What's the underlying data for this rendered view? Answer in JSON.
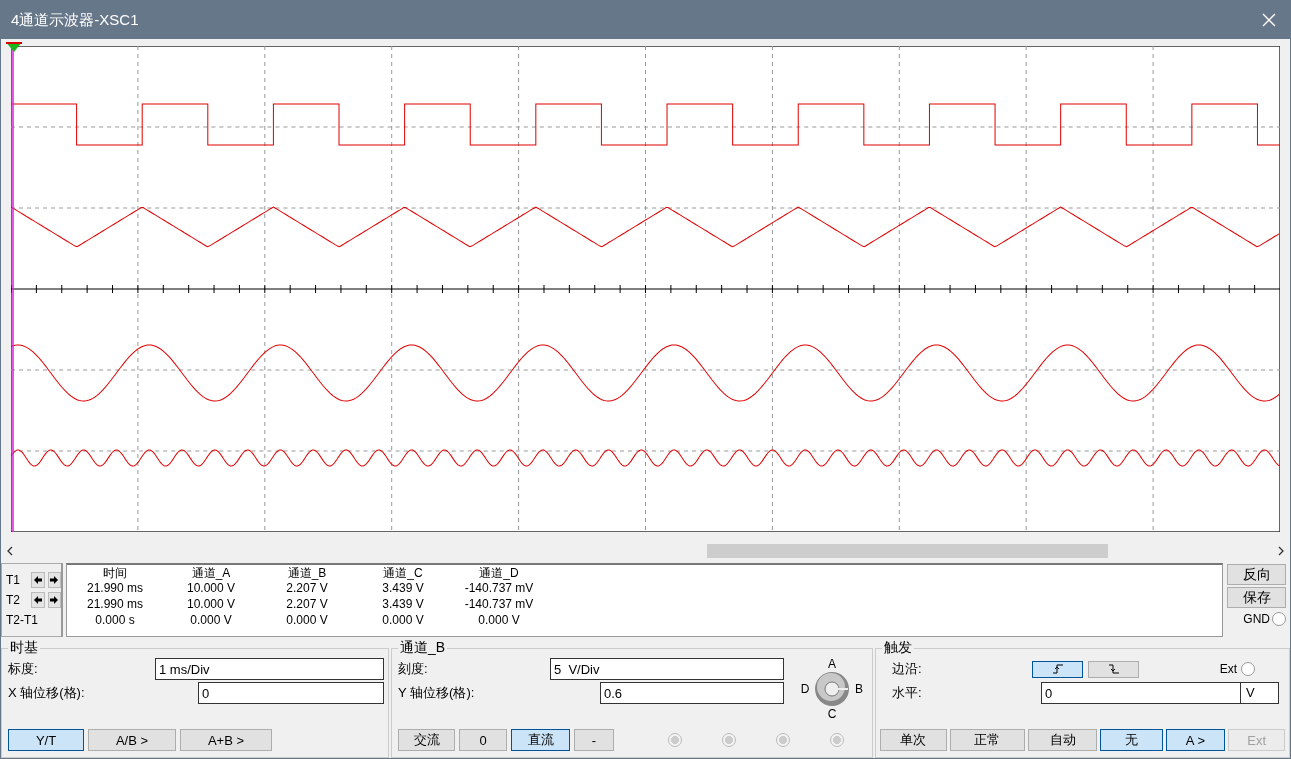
{
  "window": {
    "title": "4通道示波器-XSC1"
  },
  "display": {
    "traces": [
      {
        "kind": "square"
      },
      {
        "kind": "triangle"
      },
      {
        "kind": "sine"
      },
      {
        "kind": "ripple"
      }
    ]
  },
  "readout": {
    "columns": [
      "时间",
      "通道_A",
      "通道_B",
      "通道_C",
      "通道_D"
    ],
    "rows": [
      {
        "label": "T1",
        "arrows": true,
        "cells": [
          "21.990 ms",
          "10.000 V",
          "2.207 V",
          "3.439 V",
          "-140.737 mV"
        ]
      },
      {
        "label": "T2",
        "arrows": true,
        "cells": [
          "21.990 ms",
          "10.000 V",
          "2.207 V",
          "3.439 V",
          "-140.737 mV"
        ]
      },
      {
        "label": "T2-T1",
        "arrows": false,
        "cells": [
          "0.000 s",
          "0.000 V",
          "0.000 V",
          "0.000 V",
          "0.000 V"
        ]
      }
    ]
  },
  "side_buttons": [
    "反向",
    "保存"
  ],
  "gnd": {
    "label": "GND",
    "selected": false
  },
  "timebase": {
    "title": "时基",
    "fields": [
      {
        "label": "标度:",
        "value": "1 ms/Div"
      },
      {
        "label": "X 轴位移(格):",
        "value": "0"
      }
    ],
    "modes": [
      {
        "label": "Y/T",
        "selected": true
      },
      {
        "label": "A/B >",
        "selected": false
      },
      {
        "label": "A+B >",
        "selected": false
      }
    ]
  },
  "channel": {
    "title": "通道_B",
    "fields": [
      {
        "label": "刻度:",
        "value": "5  V/Div"
      },
      {
        "label": "Y 轴位移(格):",
        "value": "0.6"
      }
    ],
    "knob_labels": [
      "A",
      "B",
      "C",
      "D"
    ],
    "coupling": [
      {
        "label": "交流",
        "selected": false
      },
      {
        "label": "0",
        "selected": false
      },
      {
        "label": "直流",
        "selected": true
      },
      {
        "label": "-",
        "selected": false
      }
    ],
    "radios": [
      {
        "selected": false
      },
      {
        "selected": false
      },
      {
        "selected": false
      },
      {
        "selected": false
      }
    ]
  },
  "trigger": {
    "title": "触发",
    "edge_label": "边沿:",
    "edges": [
      {
        "kind": "rising",
        "selected": true
      },
      {
        "kind": "falling",
        "selected": false
      }
    ],
    "ext": {
      "label": "Ext",
      "selected": false
    },
    "level": {
      "label": "水平:",
      "value": "0",
      "unit": "V"
    },
    "modes": [
      {
        "label": "单次",
        "selected": false,
        "disabled": false
      },
      {
        "label": "正常",
        "selected": false,
        "disabled": false
      },
      {
        "label": "自动",
        "selected": false,
        "disabled": false
      },
      {
        "label": "无",
        "selected": true,
        "disabled": false
      },
      {
        "label": "A >",
        "selected": true,
        "disabled": false
      },
      {
        "label": "Ext",
        "selected": false,
        "disabled": true
      }
    ]
  }
}
